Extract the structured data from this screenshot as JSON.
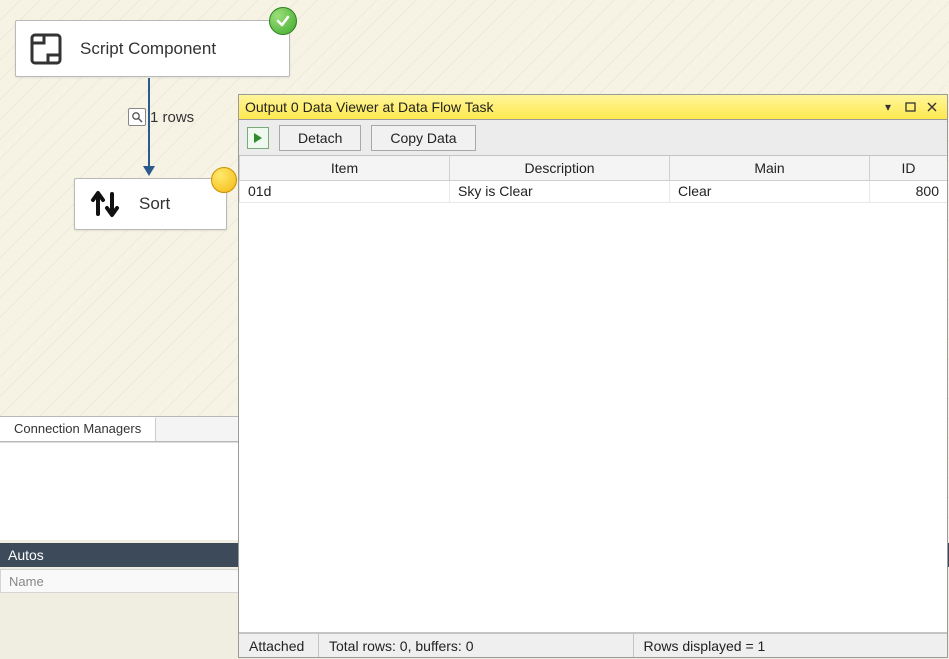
{
  "flow": {
    "script_component_label": "Script Component",
    "sort_label": "Sort",
    "row_count_text": "1 rows"
  },
  "tabs": {
    "connection_managers": "Connection Managers"
  },
  "autos": {
    "header": "Autos",
    "col_name_placeholder": "Name"
  },
  "viewer": {
    "title": "Output 0 Data Viewer at Data Flow Task",
    "toolbar": {
      "detach": "Detach",
      "copy_data": "Copy Data"
    },
    "columns": [
      "Item",
      "Description",
      "Main",
      "ID"
    ],
    "rows": [
      {
        "item": "01d",
        "description": "Sky is Clear",
        "main": "Clear",
        "id": "800"
      }
    ],
    "status": {
      "attached": "Attached",
      "totals": "Total rows: 0, buffers: 0",
      "rows_displayed": "Rows displayed = 1"
    }
  }
}
